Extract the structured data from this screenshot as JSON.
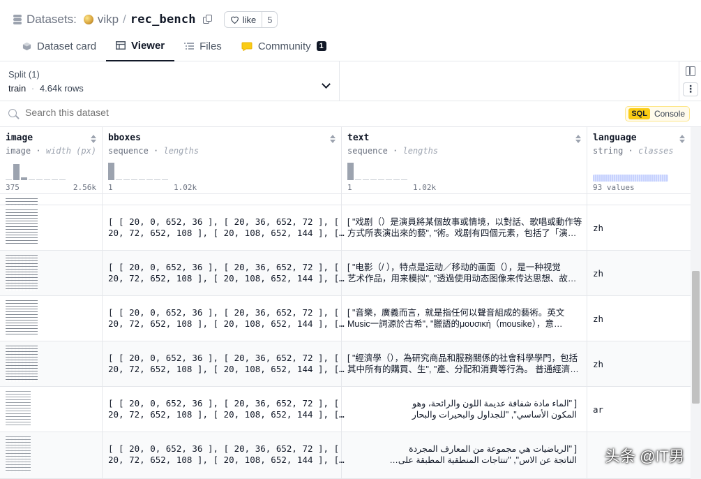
{
  "header": {
    "section_label": "Datasets:",
    "org": "vikp",
    "separator": "/",
    "repo": "rec_bench",
    "like_label": "like",
    "like_count": "5"
  },
  "tabs": [
    {
      "label": "Dataset card",
      "icon": "dataset-card-icon"
    },
    {
      "label": "Viewer",
      "icon": "table-icon",
      "active": true
    },
    {
      "label": "Files",
      "icon": "files-icon"
    },
    {
      "label": "Community",
      "icon": "community-icon",
      "badge": "1"
    }
  ],
  "split": {
    "title": "Split (1)",
    "name": "train",
    "dot": "·",
    "rows": "4.64k rows"
  },
  "search": {
    "placeholder": "Search this dataset",
    "sql_tag": "SQL",
    "console_label": "Console"
  },
  "columns": [
    {
      "name": "image",
      "type": "image",
      "stat": "width (px)",
      "min": "375",
      "max": "2.56k",
      "hist": [
        0,
        0.9,
        0.15,
        0,
        0,
        0,
        0,
        0
      ]
    },
    {
      "name": "bboxes",
      "type": "sequence",
      "stat": "lengths",
      "min": "1",
      "max": "1.02k",
      "hist": [
        0.95,
        0,
        0,
        0,
        0,
        0,
        0,
        0
      ]
    },
    {
      "name": "text",
      "type": "sequence",
      "stat": "lengths",
      "min": "1",
      "max": "1.02k",
      "hist": [
        0.95,
        0,
        0,
        0,
        0,
        0,
        0,
        0
      ]
    },
    {
      "name": "language",
      "type": "string",
      "stat": "classes",
      "values": "93 values"
    }
  ],
  "rows": [
    {
      "bboxes_1": "[ [ 20, 0, 652, 36 ], [ 20, 36, 652, 72 ], [",
      "bboxes_2": "20, 72, 652, 108 ], [ 20, 108, 652, 144 ], […",
      "text_1": "[ \"戏剧（）是演員將某個故事或情境，以對話、歌唱或動作等",
      "text_2": "方式所表演出來的藝\", \"術。戏剧有四個元素，包括了「演…",
      "language": "zh"
    },
    {
      "bboxes_1": "[ [ 20, 0, 652, 36 ], [ 20, 36, 652, 72 ], [",
      "bboxes_2": "20, 72, 652, 108 ], [ 20, 108, 652, 144 ], […",
      "text_1": "[ \"电影（/ ），特点是运动／移动的画面（），是一种视觉",
      "text_2": "艺术作品，用来模拟\", \"透過使用动态图像来传达思想、故…",
      "language": "zh"
    },
    {
      "bboxes_1": "[ [ 20, 0, 652, 36 ], [ 20, 36, 652, 72 ], [",
      "bboxes_2": "20, 72, 652, 108 ], [ 20, 108, 652, 144 ], […",
      "text_1": "[ \"音樂，廣義而言，就是指任何以聲音組成的藝術。英文",
      "text_2": "Music一詞源於古希\", \"臘語的μουσική（mousike），意…",
      "language": "zh"
    },
    {
      "bboxes_1": "[ [ 20, 0, 652, 36 ], [ 20, 36, 652, 72 ], [",
      "bboxes_2": "20, 72, 652, 108 ], [ 20, 108, 652, 144 ], […",
      "text_1": "[ \"經濟學（），為研究商品和服務關係的社會科學學門，包括",
      "text_2": "其中所有的購買、生\", \"產、分配和消費等行為。 普通經濟…",
      "language": "zh"
    },
    {
      "bboxes_1": "[ [ 20, 0, 652, 36 ], [ 20, 36, 652, 72 ], [",
      "bboxes_2": "20, 72, 652, 108 ], [ 20, 108, 652, 144 ], […",
      "text_1": "[ \"الماء مادة شفافة عديمة اللون والرائحة، وهو",
      "text_2": "المكون الأساسي\", \"للجداول والبحيرات والبحار",
      "language": "ar"
    },
    {
      "bboxes_1": "[ [ 20, 0, 652, 36 ], [ 20, 36, 652, 72 ], [",
      "bboxes_2": "20, 72, 652, 108 ], [ 20, 108, 652, 144 ], […",
      "text_1": "[ \"الرياضيات هي مجموعة من المعارف المجردة",
      "text_2": "الناتجة عن الاس\", \"تنتاجات المنطقية المطبقة على…",
      "language": ""
    }
  ],
  "watermark": "头条 @IT男"
}
